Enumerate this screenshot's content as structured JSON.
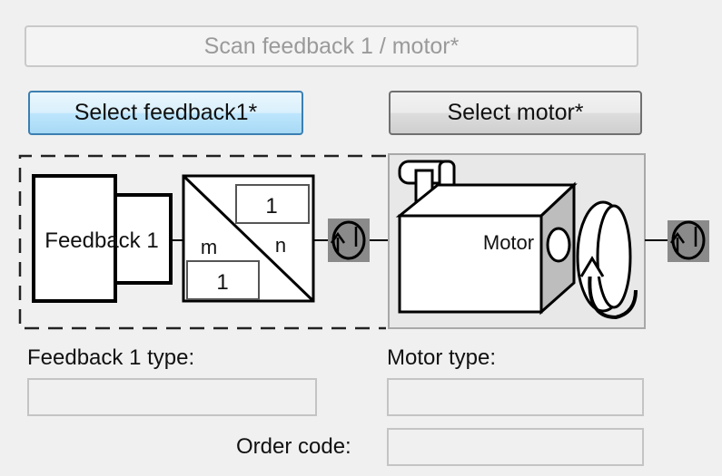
{
  "buttons": {
    "scan": "Scan feedback 1 / motor*",
    "select_feedback": "Select feedback1*",
    "select_motor": "Select motor*"
  },
  "diagram": {
    "feedback_label": "Feedback 1",
    "gear_m": "m",
    "gear_n": "n",
    "gear_numerator": "1",
    "gear_denominator": "1",
    "motor_label": "Motor"
  },
  "fields": {
    "feedback_type_label": "Feedback 1 type:",
    "feedback_type_value": "",
    "motor_type_label": "Motor type:",
    "motor_type_value": "",
    "order_code_label": "Order code:",
    "order_code_value": ""
  }
}
